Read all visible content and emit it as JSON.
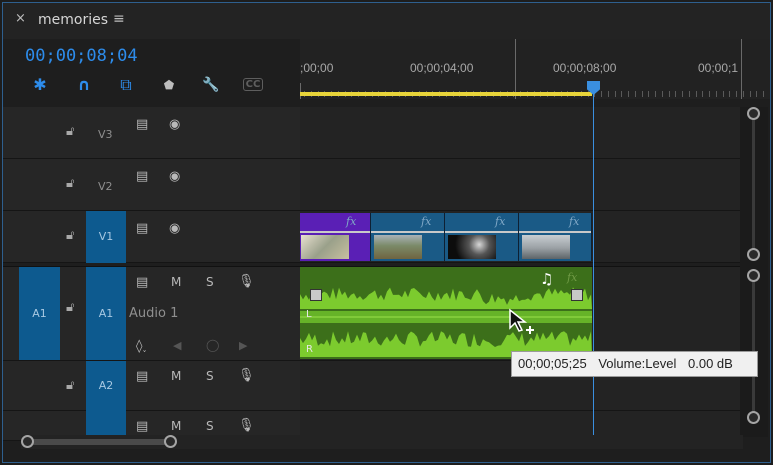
{
  "panel": {
    "close_glyph": "×",
    "title": "memories",
    "menu_glyph": "≡"
  },
  "timecode": "00;00;08;04",
  "tools": [
    {
      "name": "snap-insert-icon",
      "glyph": "✱",
      "color": "#2d8ceb"
    },
    {
      "name": "magnet-icon",
      "glyph": "∩",
      "color": "#2d8ceb"
    },
    {
      "name": "linked-selection-icon",
      "glyph": "⧉",
      "color": "#2d8ceb"
    },
    {
      "name": "marker-icon",
      "glyph": "⬟",
      "color": "#bdbdbd"
    },
    {
      "name": "wrench-icon",
      "glyph": "🔧",
      "color": "#bdbdbd"
    },
    {
      "name": "captions-icon",
      "glyph": "CC",
      "color": "#5e5e5e"
    }
  ],
  "ruler": {
    "labels": [
      ";00;00",
      "00;00;04;00",
      "00;00;08;00",
      "00;00;1"
    ]
  },
  "tracks": {
    "v3": {
      "name": "V3"
    },
    "v2": {
      "name": "V2"
    },
    "v1": {
      "name": "V1"
    },
    "a1": {
      "source": "A1",
      "name": "A1",
      "label": "Audio 1",
      "m": "M",
      "s": "S"
    },
    "a2": {
      "name": "A2",
      "m": "M",
      "s": "S"
    },
    "a3": {
      "m": "M",
      "s": "S"
    }
  },
  "clips": {
    "fx": "fx",
    "channel_l": "L",
    "channel_r": "R",
    "music_glyph": "♫"
  },
  "tooltip": {
    "time": "00;00;05;25",
    "param": "Volume:Level",
    "value": "0.00 dB"
  },
  "colors": {
    "accent": "#2d8ceb",
    "track_target": "#0d5a8f",
    "audio_clip": "#3c6f1a",
    "waveform": "#7ccb2e",
    "work_area": "#e8d43a",
    "video_clip_first": "#5a1fb5",
    "video_clip": "#1a5a86"
  }
}
